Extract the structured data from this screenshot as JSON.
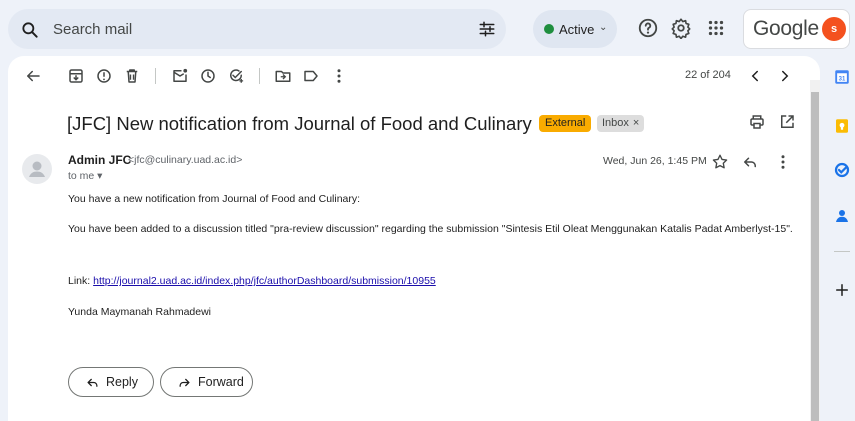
{
  "search": {
    "placeholder": "Search mail"
  },
  "status": {
    "label": "Active",
    "color": "#1e8e3e"
  },
  "brand": {
    "name": "Google",
    "avatar_letter": "s",
    "avatar_color": "#f4511e"
  },
  "toolbar": {
    "count": "22 of 204"
  },
  "email": {
    "subject": "[JFC] New notification from Journal of Food and Culinary",
    "labels": {
      "external": "External",
      "inbox": "Inbox",
      "inbox_remove": "×"
    },
    "sender_name": "Admin JFC",
    "sender_email": "<jfc@culinary.uad.ac.id>",
    "to": "to me ▾",
    "date": "Wed, Jun 26, 1:45 PM",
    "body": {
      "line1": "You have a new notification from Journal of Food and Culinary:",
      "line2": "You have been added to a discussion titled \"pra-review discussion\" regarding the submission \"Sintesis Etil Oleat Menggunakan Katalis Padat Amberlyst-15\".",
      "link_prefix": "Link: ",
      "link": "http://journal2.uad.ac.id/index.php/jfc/authorDashboard/submission/10955",
      "signature": "Yunda Maymanah Rahmadewi"
    }
  },
  "actions": {
    "reply": "Reply",
    "forward": "Forward"
  }
}
